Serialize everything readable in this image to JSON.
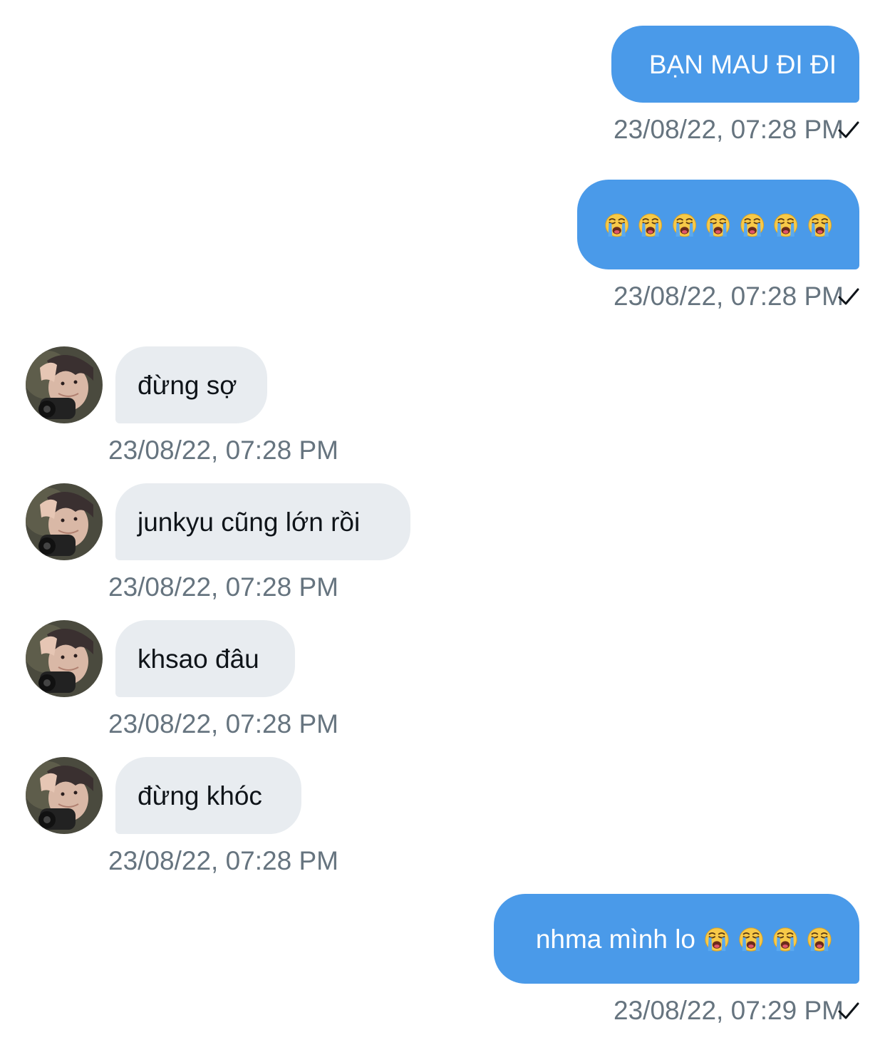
{
  "conversation": {
    "messages": [
      {
        "direction": "sent",
        "text": "BẠN MAU ĐI ĐI",
        "timestamp": "23/08/22, 07:28 PM",
        "status_icon": "check-icon"
      },
      {
        "direction": "sent",
        "text": "",
        "emoji": [
          "loudly-crying-face",
          "loudly-crying-face",
          "loudly-crying-face",
          "loudly-crying-face",
          "loudly-crying-face",
          "loudly-crying-face",
          "loudly-crying-face"
        ],
        "timestamp": "23/08/22, 07:28 PM",
        "status_icon": "check-icon"
      },
      {
        "direction": "received",
        "text": "đừng sợ",
        "timestamp": "23/08/22, 07:28 PM",
        "avatar": "avatar-photo"
      },
      {
        "direction": "received",
        "text": "junkyu cũng lớn rồi",
        "timestamp": "23/08/22, 07:28 PM",
        "avatar": "avatar-photo"
      },
      {
        "direction": "received",
        "text": "khsao đâu",
        "timestamp": "23/08/22, 07:28 PM",
        "avatar": "avatar-photo"
      },
      {
        "direction": "received",
        "text": "đừng khóc",
        "timestamp": "23/08/22, 07:28 PM",
        "avatar": "avatar-photo"
      },
      {
        "direction": "sent",
        "text": "nhma mình lo",
        "emoji": [
          "loudly-crying-face",
          "loudly-crying-face",
          "loudly-crying-face",
          "loudly-crying-face"
        ],
        "timestamp": "23/08/22, 07:29 PM",
        "status_icon": "check-icon"
      }
    ]
  },
  "colors": {
    "sent_bubble": "#4a9ae9",
    "received_bubble": "#e8ecf0",
    "timestamp": "#66747f",
    "background": "#ffffff"
  }
}
